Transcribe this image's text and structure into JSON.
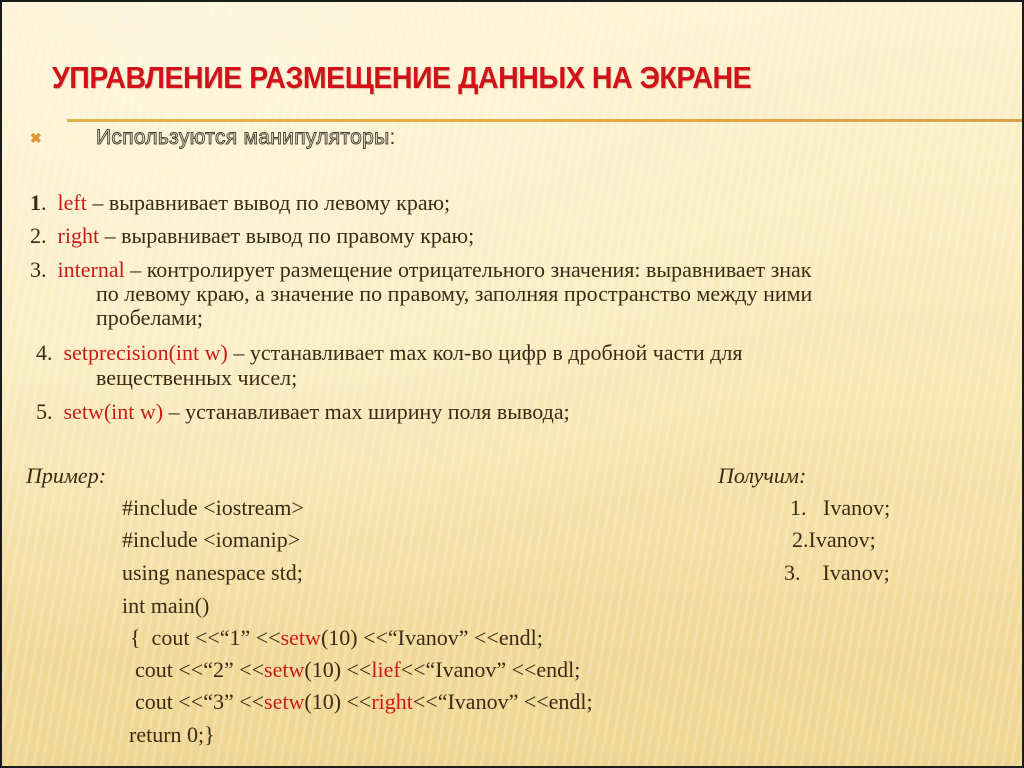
{
  "slide": {
    "title": "УПРАВЛЕНИЕ РАЗМЕЩЕНИЕ ДАННЫХ НА ЭКРАНЕ",
    "bullet": {
      "icon": "x-bullet-icon",
      "text": "Используются манипуляторы",
      "suffix": ":"
    },
    "colors": {
      "title": "#d0121a",
      "keyword": "#cc1a1a",
      "text": "#3b2a14",
      "divider": "#e6a83e",
      "bullet": "#e0952e",
      "background": "#f9e8b6"
    },
    "manipulators": [
      {
        "num": "1",
        "dot": ".",
        "keyword": "left",
        "desc": " – выравнивает вывод по левому краю;",
        "cont": []
      },
      {
        "num": "2.",
        "dot": "",
        "keyword": "right",
        "desc": " – выравнивает вывод по правому краю;",
        "cont": []
      },
      {
        "num": "3.",
        "dot": "",
        "keyword": "internal",
        "desc": " – контролирует размещение отрицательного значения: выравнивает знак",
        "cont": [
          "по левому краю, а значение по правому, заполняя пространство между ними",
          "пробелами;"
        ]
      },
      {
        "num": "4.",
        "dot": "",
        "keyword": "setprecision(int w)",
        "desc": " – устанавливает max кол-во цифр в дробной части для",
        "cont": [
          "вещественных чисел;"
        ]
      },
      {
        "num": "5.",
        "dot": "",
        "keyword": "setw(int w)",
        "desc": " – устанавливает max ширину поля вывода;",
        "cont": []
      }
    ],
    "example": {
      "label": "Пример:",
      "code": [
        {
          "parts": [
            {
              "t": "#include <iostream>",
              "red": false
            }
          ]
        },
        {
          "parts": [
            {
              "t": "#include <iomanip>",
              "red": false
            }
          ]
        },
        {
          "parts": [
            {
              "t": "using nanespace std;",
              "red": false
            }
          ]
        },
        {
          "parts": [
            {
              "t": "int main()",
              "red": false
            }
          ]
        },
        {
          "parts": [
            {
              "t": "{  cout <<“1” <<",
              "red": false
            },
            {
              "t": "setw",
              "red": true
            },
            {
              "t": "(10) <<“Ivanov” <<endl;",
              "red": false
            }
          ]
        },
        {
          "parts": [
            {
              "t": "cout <<“2” <<",
              "red": false
            },
            {
              "t": "setw",
              "red": true
            },
            {
              "t": "(10) <<",
              "red": false
            },
            {
              "t": "lief",
              "red": true
            },
            {
              "t": "<<“Ivanov” <<endl;",
              "red": false
            }
          ]
        },
        {
          "parts": [
            {
              "t": "cout <<“3” <<",
              "red": false
            },
            {
              "t": "setw",
              "red": true
            },
            {
              "t": "(10) <<",
              "red": false
            },
            {
              "t": "right",
              "red": true
            },
            {
              "t": "<<“Ivanov” <<endl;",
              "red": false
            }
          ]
        },
        {
          "parts": [
            {
              "t": "return 0;}",
              "red": false
            }
          ]
        }
      ]
    },
    "result": {
      "label": "Получим:",
      "lines": [
        "1.   Ivanov;",
        "2.Ivanov;",
        "3.    Ivanov;"
      ]
    }
  }
}
